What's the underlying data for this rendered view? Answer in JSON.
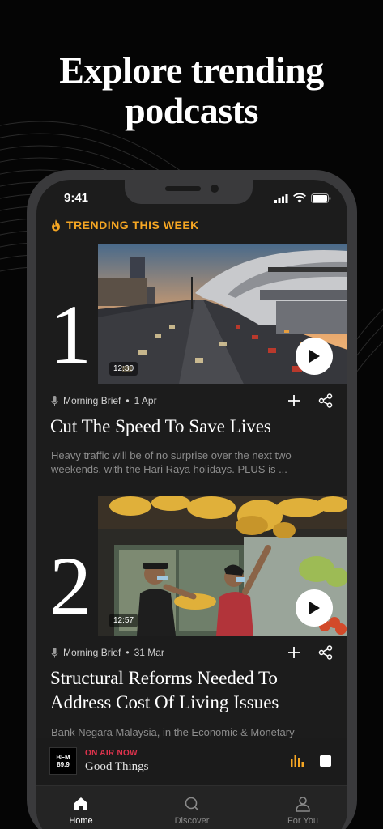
{
  "headline": "Explore trending podcasts",
  "status_bar": {
    "time": "9:41"
  },
  "section": {
    "label": "TRENDING THIS WEEK",
    "icon": "flame-icon"
  },
  "episodes": [
    {
      "rank": "1",
      "duration": "12:30",
      "show": "Morning Brief",
      "date": "1 Apr",
      "title": "Cut The Speed To Save Lives",
      "description": "Heavy traffic will be of no surprise over the next two weekends, with the Hari Raya holidays. PLUS is ..."
    },
    {
      "rank": "2",
      "duration": "12:57",
      "show": "Morning Brief",
      "date": "31 Mar",
      "title": "Structural Reforms Needed To Address Cost Of Living Issues",
      "description": "Bank Negara Malaysia, in the Economic & Monetary"
    }
  ],
  "separator": "•",
  "now_playing": {
    "logo_line1": "BFM",
    "logo_line2": "89.9",
    "status": "ON AIR NOW",
    "show": "Good Things"
  },
  "tabs": [
    {
      "label": "Home",
      "icon": "home-icon",
      "active": true
    },
    {
      "label": "Discover",
      "icon": "search-icon",
      "active": false
    },
    {
      "label": "For You",
      "icon": "person-icon",
      "active": false
    }
  ],
  "colors": {
    "accent": "#f5a623",
    "on_air": "#e0334d",
    "background": "#1c1c1c"
  }
}
